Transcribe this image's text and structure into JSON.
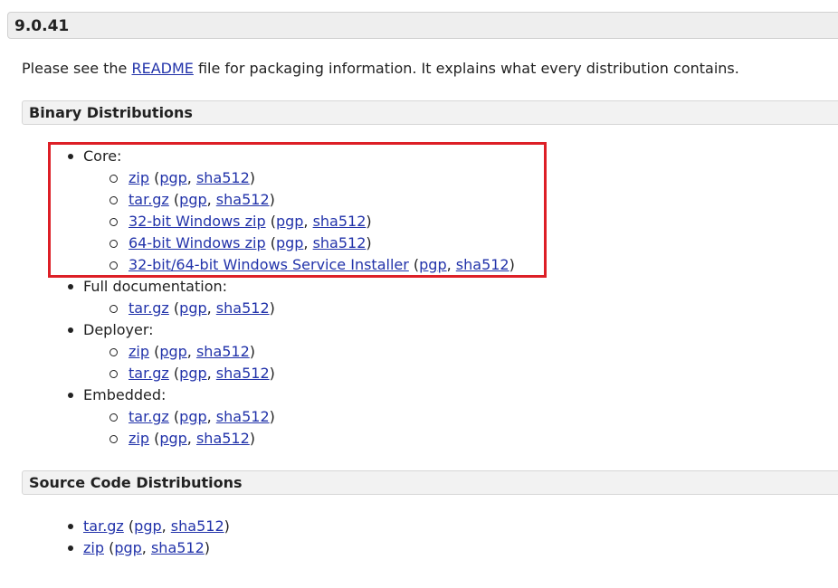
{
  "version_title": "9.0.41",
  "intro": {
    "before": "Please see the ",
    "link": "README",
    "after": " file for packaging information. It explains what every distribution contains."
  },
  "binary": {
    "title": "Binary Distributions",
    "groups": [
      {
        "label": "Core:",
        "items": [
          {
            "name": "zip",
            "pgp": "pgp",
            "sha": "sha512"
          },
          {
            "name": "tar.gz",
            "pgp": "pgp",
            "sha": "sha512"
          },
          {
            "name": "32-bit Windows zip",
            "pgp": "pgp",
            "sha": "sha512"
          },
          {
            "name": "64-bit Windows zip",
            "pgp": "pgp",
            "sha": "sha512"
          },
          {
            "name": "32-bit/64-bit Windows Service Installer",
            "pgp": "pgp",
            "sha": "sha512"
          }
        ]
      },
      {
        "label": "Full documentation:",
        "items": [
          {
            "name": "tar.gz",
            "pgp": "pgp",
            "sha": "sha512"
          }
        ]
      },
      {
        "label": "Deployer:",
        "items": [
          {
            "name": "zip",
            "pgp": "pgp",
            "sha": "sha512"
          },
          {
            "name": "tar.gz",
            "pgp": "pgp",
            "sha": "sha512"
          }
        ]
      },
      {
        "label": "Embedded:",
        "items": [
          {
            "name": "tar.gz",
            "pgp": "pgp",
            "sha": "sha512"
          },
          {
            "name": "zip",
            "pgp": "pgp",
            "sha": "sha512"
          }
        ]
      }
    ]
  },
  "source": {
    "title": "Source Code Distributions",
    "items": [
      {
        "name": "tar.gz",
        "pgp": "pgp",
        "sha": "sha512"
      },
      {
        "name": "zip",
        "pgp": "pgp",
        "sha": "sha512"
      }
    ]
  },
  "colors": {
    "link": "#2233aa",
    "highlight": "#dd1f26",
    "header_bg": "#eeeeee"
  }
}
